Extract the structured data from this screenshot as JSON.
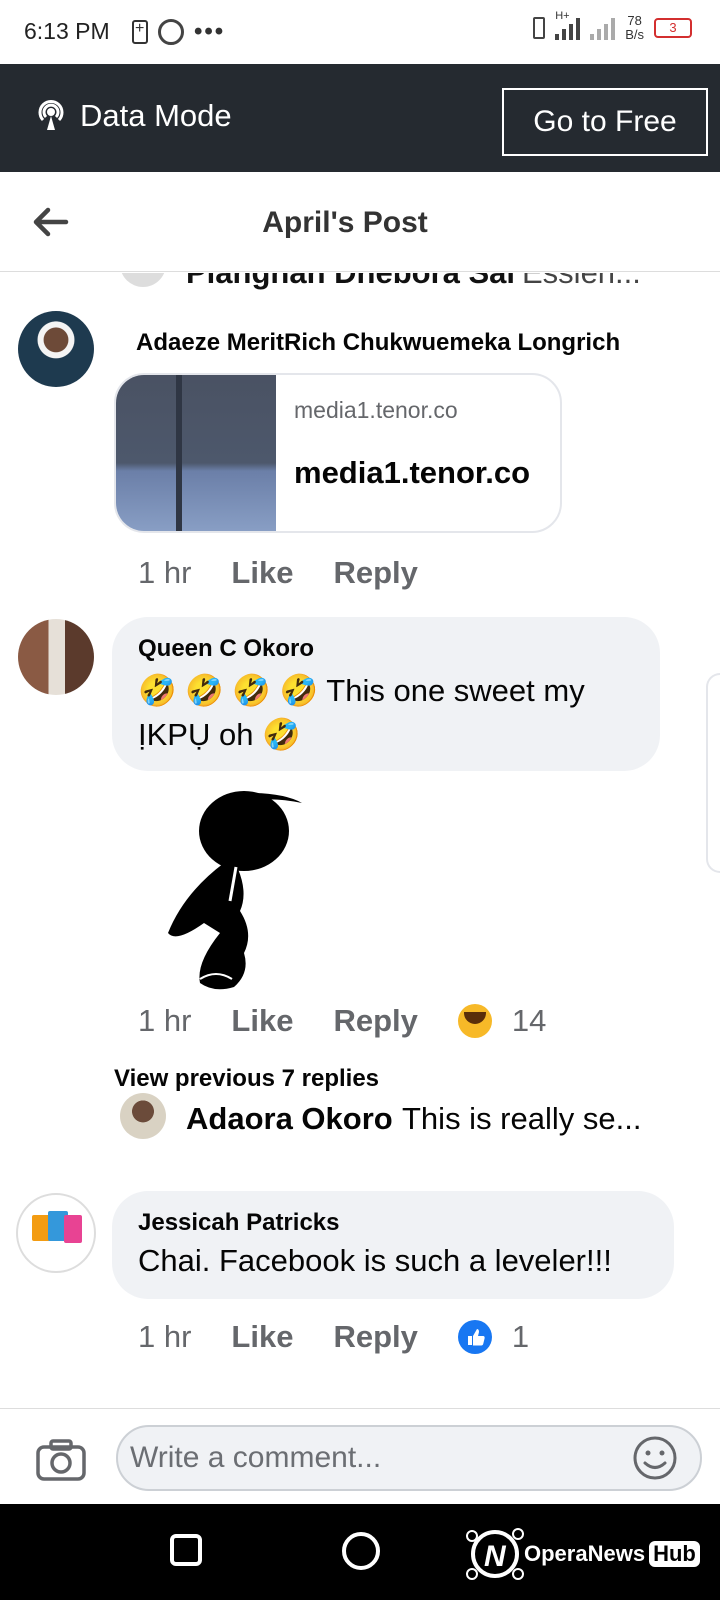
{
  "status_bar": {
    "time": "6:13 PM",
    "network_type": "H+",
    "speed_value": "78",
    "speed_unit": "B/s",
    "battery_level": "3"
  },
  "data_mode": {
    "label": "Data Mode",
    "go_free_label": "Go to Free"
  },
  "header": {
    "title": "April's Post"
  },
  "partial_reply": {
    "name": "Pianghan Dhebora Sai",
    "text": "Essien..."
  },
  "comments": [
    {
      "name": "Adaeze MeritRich Chukwuemeka Longrich",
      "link_domain": "media1.tenor.co",
      "link_title": "media1.tenor.co",
      "time": "1 hr",
      "like_label": "Like",
      "reply_label": "Reply"
    },
    {
      "name": "Queen C Okoro",
      "text": "🤣 🤣 🤣 🤣 This one sweet my ỊKPỤ oh 🤣",
      "time": "1 hr",
      "like_label": "Like",
      "reply_label": "Reply",
      "reaction": "haha",
      "reaction_count": "14"
    },
    {
      "name": "Jessicah Patricks",
      "text": "Chai. Facebook is such a leveler!!!",
      "time": "1 hr",
      "like_label": "Like",
      "reply_label": "Reply",
      "reaction": "like",
      "reaction_count": "1"
    }
  ],
  "view_previous": "View previous 7 replies",
  "reply_preview": {
    "name": "Adaora Okoro",
    "text": "This is really se..."
  },
  "composer": {
    "placeholder": "Write a comment..."
  },
  "watermark": {
    "brand": "OperaNews",
    "hub": "Hub"
  },
  "colors": {
    "data_bar": "#252a30",
    "bubble": "#f0f2f5",
    "meta_text": "#65676b",
    "like_blue": "#1877f2",
    "haha_yellow": "#f7b928"
  }
}
